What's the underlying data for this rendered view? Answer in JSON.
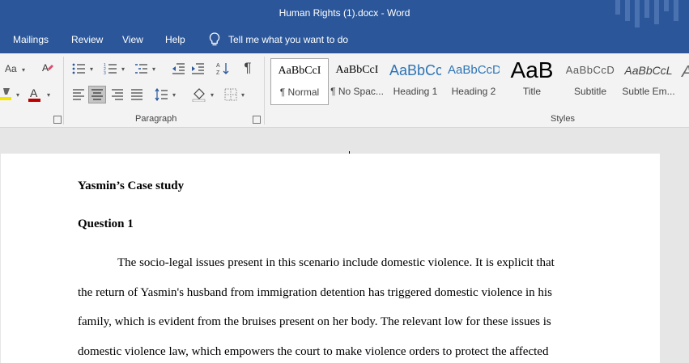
{
  "window": {
    "title": "Human Rights (1).docx  -  Word",
    "brand_color": "#2b579a"
  },
  "menu": {
    "items": [
      "Mailings",
      "Review",
      "View",
      "Help"
    ],
    "tell_me": "Tell me what you want to do"
  },
  "ribbon": {
    "paragraph_group_label": "Paragraph",
    "styles_group_label": "Styles",
    "font_size_label": "Aa",
    "styles": [
      {
        "preview": "AaBbCcI",
        "name": "¶ Normal"
      },
      {
        "preview": "AaBbCcI",
        "name": "¶ No Spac..."
      },
      {
        "preview": "AaBbCc",
        "name": "Heading 1"
      },
      {
        "preview": "AaBbCcD",
        "name": "Heading 2"
      },
      {
        "preview": "AaB",
        "name": "Title"
      },
      {
        "preview": "AaBbCcD",
        "name": "Subtitle"
      },
      {
        "preview": "AaBbCcL",
        "name": "Subtle Em..."
      }
    ]
  },
  "document": {
    "heading1": "Yasmin’s Case study",
    "heading2": "Question 1",
    "lines": [
      "The socio-legal issues present in this scenario include domestic violence. It is explicit that",
      "the return of Yasmin's husband from immigration detention has triggered domestic violence in his",
      "family, which is evident from the bruises present on her body. The relevant low for these issues is",
      "domestic violence law, which empowers the court to make violence orders to protect the affected"
    ]
  }
}
